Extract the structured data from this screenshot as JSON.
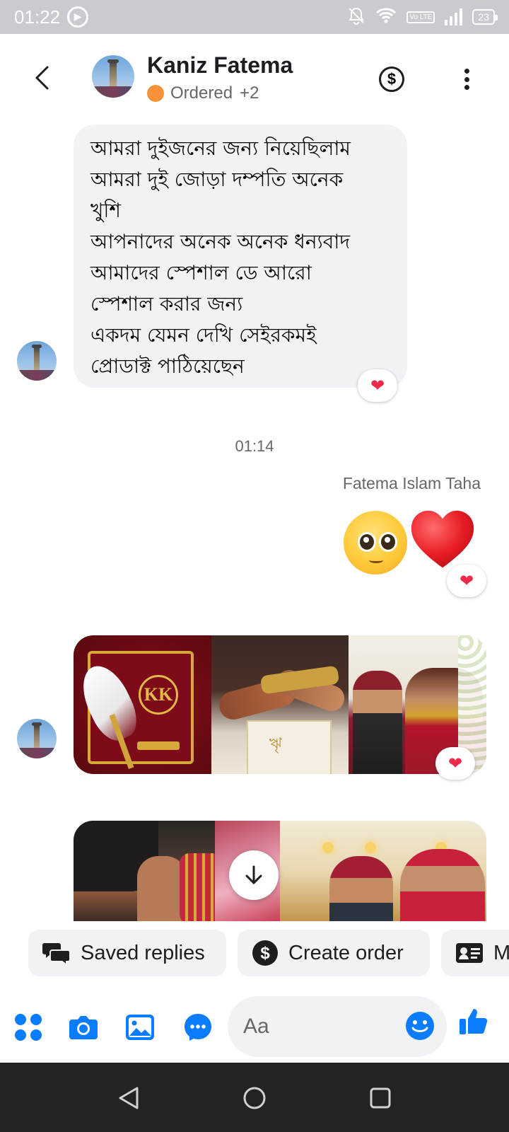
{
  "status_bar": {
    "time": "01:22",
    "sync_icon": "sync-circle-icon",
    "lte_label": "Vo LTE",
    "battery": "23"
  },
  "header": {
    "name": "Kaniz Fatema",
    "status_label": "Ordered",
    "status_extra": "+2",
    "status_color": "#f7923a"
  },
  "messages": {
    "incoming_text_lines": [
      "আমরা দুইজনের জন্য নিয়েছিলাম",
      "আমরা দুই জোড়া দম্পতি অনেক",
      "খুশি",
      "আপনাদের অনেক অনেক ধন্যবাদ",
      "আমাদের স্পেশাল ডে আরো",
      "স্পেশাল করার জন্য",
      "একদম যেমন দেখি সেইরকমই",
      "প্রোডাক্ট পাঠিয়েছেন"
    ],
    "incoming_reaction": "❤",
    "time_separator": "01:14",
    "outgoing_sender": "Fatema Islam Taha",
    "outgoing_emojis": [
      "pleading-face-emoji",
      "red-heart-emoji"
    ],
    "outgoing_reaction": "❤",
    "photo_reaction": "❤",
    "photo_monogram": "KK",
    "photo_script_text": "ৠ"
  },
  "quick_replies": {
    "saved_replies": "Saved replies",
    "create_order": "Create order",
    "more_label": "M"
  },
  "composer": {
    "placeholder": "Aa"
  },
  "colors": {
    "accent": "#0a7cff",
    "bubble_in": "#f0f2f5",
    "reaction_heart": "#f02849"
  }
}
